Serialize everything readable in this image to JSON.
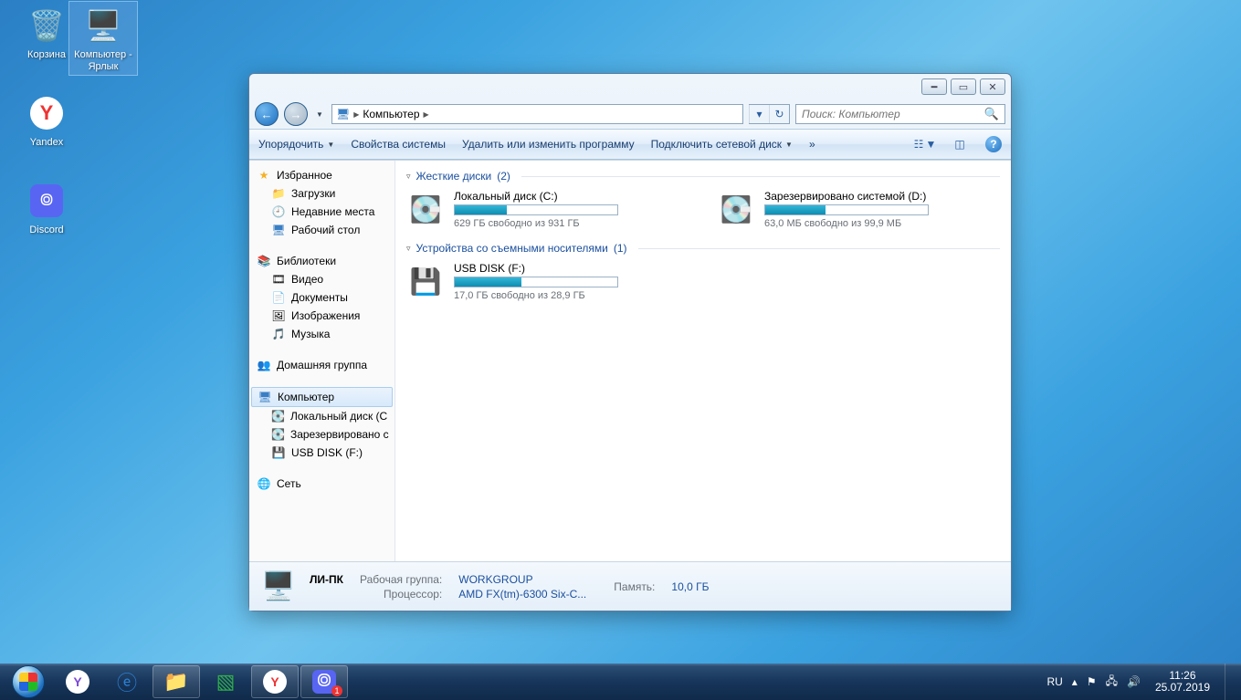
{
  "desktop_icons": [
    {
      "id": "recycle",
      "label": "Корзина"
    },
    {
      "id": "computer",
      "label": "Компьютер - Ярлык"
    },
    {
      "id": "yandex",
      "label": "Yandex"
    },
    {
      "id": "discord",
      "label": "Discord"
    }
  ],
  "window": {
    "breadcrumb": "Компьютер",
    "search_placeholder": "Поиск: Компьютер",
    "toolbar": {
      "organize": "Упорядочить",
      "props": "Свойства системы",
      "uninstall": "Удалить или изменить программу",
      "map_drive": "Подключить сетевой диск",
      "more": "»"
    },
    "nav": {
      "favorites": "Избранное",
      "downloads": "Загрузки",
      "recent": "Недавние места",
      "desktop": "Рабочий стол",
      "libraries": "Библиотеки",
      "video": "Видео",
      "documents": "Документы",
      "pictures": "Изображения",
      "music": "Музыка",
      "homegroup": "Домашняя группа",
      "computer": "Компьютер",
      "drive_c": "Локальный диск (C",
      "drive_d": "Зарезервировано с",
      "drive_f": "USB DISK (F:)",
      "network": "Сеть"
    },
    "groups": {
      "hdd": {
        "label": "Жесткие диски",
        "count": "(2)"
      },
      "removable": {
        "label": "Устройства со съемными носителями",
        "count": "(1)"
      }
    },
    "drives": {
      "c": {
        "name": "Локальный диск (C:)",
        "status": "629 ГБ свободно из 931 ГБ",
        "fill": 32
      },
      "d": {
        "name": "Зарезервировано системой (D:)",
        "status": "63,0 МБ свободно из 99,9 МБ",
        "fill": 37
      },
      "f": {
        "name": "USB DISK (F:)",
        "status": "17,0 ГБ свободно из 28,9 ГБ",
        "fill": 41
      }
    },
    "details": {
      "name": "ЛИ-ПК",
      "workgroup_label": "Рабочая группа:",
      "workgroup": "WORKGROUP",
      "cpu_label": "Процессор:",
      "cpu": "AMD FX(tm)-6300 Six-C...",
      "mem_label": "Память:",
      "mem": "10,0 ГБ"
    }
  },
  "tray": {
    "lang": "RU",
    "time": "11:26",
    "date": "25.07.2019"
  }
}
